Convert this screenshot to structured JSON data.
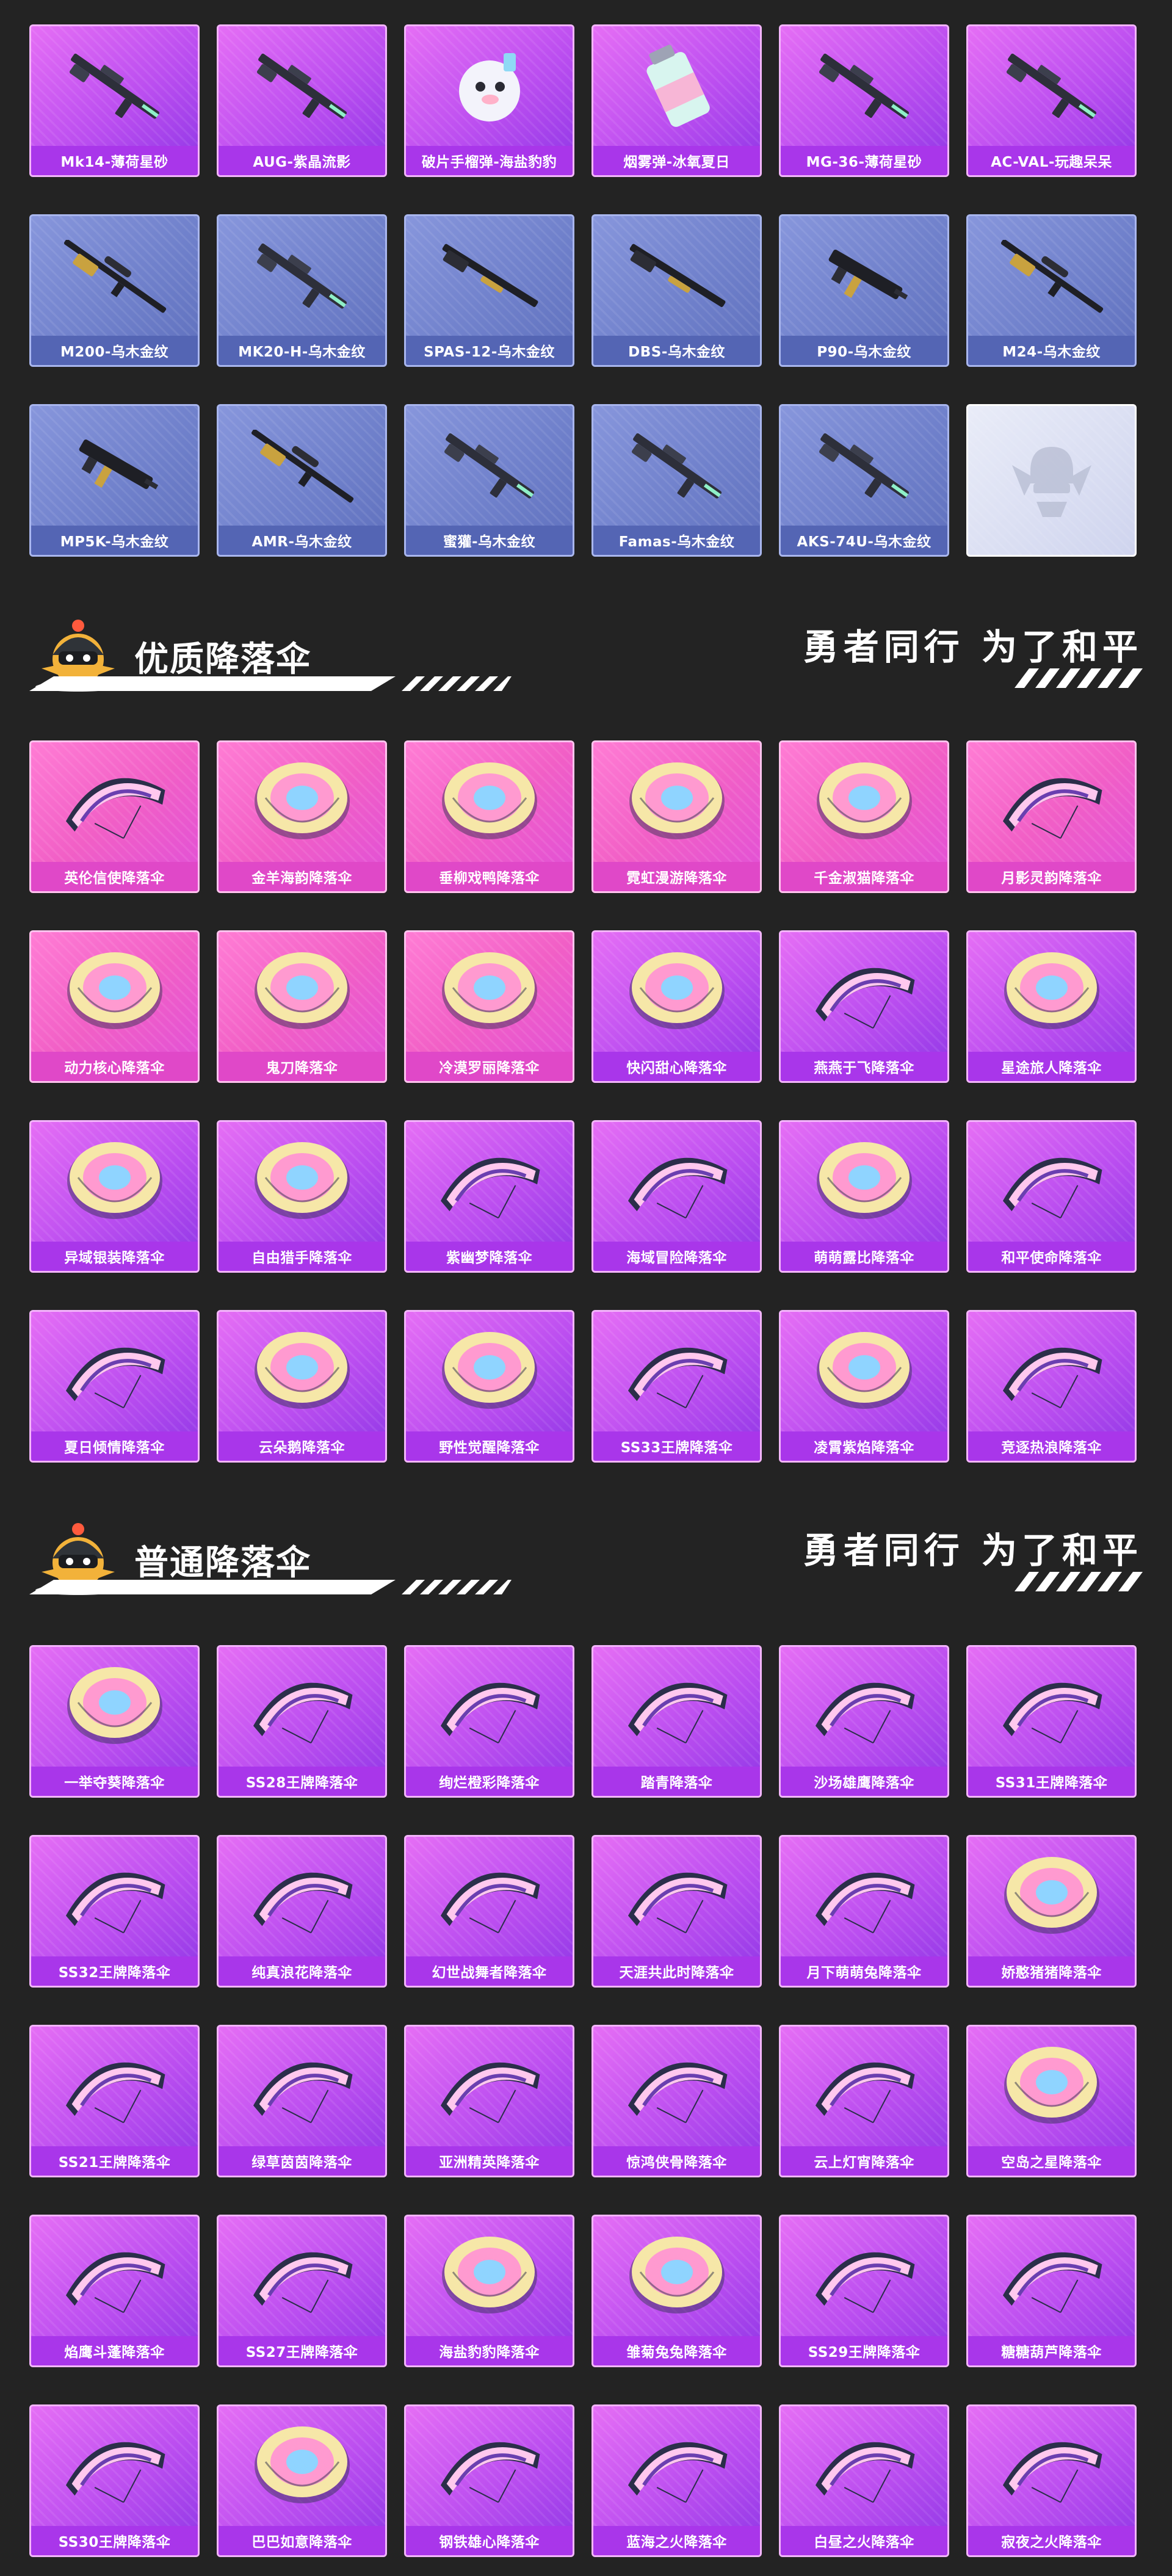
{
  "colors": {
    "page_bg": "#232323",
    "blue_card": "#6e7fca",
    "purple_card": "#bb4ef0",
    "pink_card": "#f15fc6",
    "label_text": "#ffffff"
  },
  "weapons": {
    "rows": [
      [
        {
          "label": "Mk14-薄荷星砂",
          "style": "purple",
          "icon": "rifle-icon"
        },
        {
          "label": "AUG-紫晶流影",
          "style": "purple",
          "icon": "rifle-icon"
        },
        {
          "label": "破片手榴弹-海盐豹豹",
          "style": "purple",
          "icon": "grenade-icon"
        },
        {
          "label": "烟雾弹-冰氧夏日",
          "style": "purple",
          "icon": "smoke-grenade-icon"
        },
        {
          "label": "MG-36-薄荷星砂",
          "style": "purple",
          "icon": "rifle-icon"
        },
        {
          "label": "AC-VAL-玩趣呆呆",
          "style": "purple",
          "icon": "rifle-icon"
        }
      ],
      [
        {
          "label": "M200-乌木金纹",
          "style": "blue",
          "icon": "sniper-rifle-icon"
        },
        {
          "label": "MK20-H-乌木金纹",
          "style": "blue",
          "icon": "rifle-icon"
        },
        {
          "label": "SPAS-12-乌木金纹",
          "style": "blue",
          "icon": "shotgun-icon"
        },
        {
          "label": "DBS-乌木金纹",
          "style": "blue",
          "icon": "shotgun-icon"
        },
        {
          "label": "P90-乌木金纹",
          "style": "blue",
          "icon": "smg-icon"
        },
        {
          "label": "M24-乌木金纹",
          "style": "blue",
          "icon": "sniper-rifle-icon"
        }
      ],
      [
        {
          "label": "MP5K-乌木金纹",
          "style": "blue",
          "icon": "smg-icon"
        },
        {
          "label": "AMR-乌木金纹",
          "style": "blue",
          "icon": "sniper-rifle-icon"
        },
        {
          "label": "蜜獾-乌木金纹",
          "style": "blue",
          "icon": "rifle-icon"
        },
        {
          "label": "Famas-乌木金纹",
          "style": "blue",
          "icon": "rifle-icon"
        },
        {
          "label": "AKS-74U-乌木金纹",
          "style": "blue",
          "icon": "rifle-icon"
        },
        {
          "label": "",
          "style": "empty",
          "icon": "game-emblem-icon"
        }
      ]
    ]
  },
  "section_premium": {
    "title": "优质降落伞",
    "slogan": "勇者同行 为了和平",
    "rows": [
      [
        {
          "label": "英伦信使降落伞",
          "style": "pink",
          "icon": "glider-icon"
        },
        {
          "label": "金羊海韵降落伞",
          "style": "pink",
          "icon": "parachute-icon"
        },
        {
          "label": "垂柳戏鸭降落伞",
          "style": "pink",
          "icon": "parachute-icon"
        },
        {
          "label": "霓虹漫游降落伞",
          "style": "pink",
          "icon": "parachute-icon"
        },
        {
          "label": "千金淑猫降落伞",
          "style": "pink",
          "icon": "parachute-icon"
        },
        {
          "label": "月影灵韵降落伞",
          "style": "pink",
          "icon": "glider-icon"
        }
      ],
      [
        {
          "label": "动力核心降落伞",
          "style": "pink",
          "icon": "parachute-icon"
        },
        {
          "label": "鬼刀降落伞",
          "style": "pink",
          "icon": "parachute-icon"
        },
        {
          "label": "冷漠罗丽降落伞",
          "style": "pink",
          "icon": "parachute-icon"
        },
        {
          "label": "快闪甜心降落伞",
          "style": "purple",
          "icon": "parachute-icon"
        },
        {
          "label": "燕燕于飞降落伞",
          "style": "purple",
          "icon": "glider-icon"
        },
        {
          "label": "星途旅人降落伞",
          "style": "purple",
          "icon": "parachute-icon"
        }
      ],
      [
        {
          "label": "异域银装降落伞",
          "style": "purple",
          "icon": "parachute-icon"
        },
        {
          "label": "自由猎手降落伞",
          "style": "purple",
          "icon": "parachute-icon"
        },
        {
          "label": "紫幽梦降落伞",
          "style": "purple",
          "icon": "glider-icon"
        },
        {
          "label": "海域冒险降落伞",
          "style": "purple",
          "icon": "glider-icon"
        },
        {
          "label": "萌萌露比降落伞",
          "style": "purple",
          "icon": "parachute-icon"
        },
        {
          "label": "和平使命降落伞",
          "style": "purple",
          "icon": "glider-icon"
        }
      ],
      [
        {
          "label": "夏日倾情降落伞",
          "style": "purple",
          "icon": "glider-icon"
        },
        {
          "label": "云朵鹅降落伞",
          "style": "purple",
          "icon": "parachute-icon"
        },
        {
          "label": "野性觉醒降落伞",
          "style": "purple",
          "icon": "parachute-icon"
        },
        {
          "label": "SS33王牌降落伞",
          "style": "purple",
          "icon": "glider-icon"
        },
        {
          "label": "凌霄紫焰降落伞",
          "style": "purple",
          "icon": "parachute-icon"
        },
        {
          "label": "竞逐热浪降落伞",
          "style": "purple",
          "icon": "glider-icon"
        }
      ]
    ]
  },
  "section_common": {
    "title": "普通降落伞",
    "slogan": "勇者同行 为了和平",
    "rows": [
      [
        {
          "label": "一举夺葵降落伞",
          "style": "purple",
          "icon": "parachute-icon"
        },
        {
          "label": "SS28王牌降落伞",
          "style": "purple",
          "icon": "glider-icon"
        },
        {
          "label": "绚烂橙彩降落伞",
          "style": "purple",
          "icon": "glider-icon"
        },
        {
          "label": "踏青降落伞",
          "style": "purple",
          "icon": "glider-icon"
        },
        {
          "label": "沙场雄鹰降落伞",
          "style": "purple",
          "icon": "glider-icon"
        },
        {
          "label": "SS31王牌降落伞",
          "style": "purple",
          "icon": "glider-icon"
        }
      ],
      [
        {
          "label": "SS32王牌降落伞",
          "style": "purple",
          "icon": "glider-icon"
        },
        {
          "label": "纯真浪花降落伞",
          "style": "purple",
          "icon": "glider-icon"
        },
        {
          "label": "幻世战舞者降落伞",
          "style": "purple",
          "icon": "glider-icon"
        },
        {
          "label": "天涯共此时降落伞",
          "style": "purple",
          "icon": "glider-icon"
        },
        {
          "label": "月下萌萌兔降落伞",
          "style": "purple",
          "icon": "glider-icon"
        },
        {
          "label": "娇憨猪猪降落伞",
          "style": "purple",
          "icon": "parachute-icon"
        }
      ],
      [
        {
          "label": "SS21王牌降落伞",
          "style": "purple",
          "icon": "glider-icon"
        },
        {
          "label": "绿草茵茵降落伞",
          "style": "purple",
          "icon": "glider-icon"
        },
        {
          "label": "亚洲精英降落伞",
          "style": "purple",
          "icon": "glider-icon"
        },
        {
          "label": "惊鸿侠骨降落伞",
          "style": "purple",
          "icon": "glider-icon"
        },
        {
          "label": "云上灯宵降落伞",
          "style": "purple",
          "icon": "glider-icon"
        },
        {
          "label": "空岛之星降落伞",
          "style": "purple",
          "icon": "parachute-icon"
        }
      ],
      [
        {
          "label": "焰鹰斗蓬降落伞",
          "style": "purple",
          "icon": "glider-icon"
        },
        {
          "label": "SS27王牌降落伞",
          "style": "purple",
          "icon": "glider-icon"
        },
        {
          "label": "海盐豹豹降落伞",
          "style": "purple",
          "icon": "parachute-icon"
        },
        {
          "label": "雏菊兔兔降落伞",
          "style": "purple",
          "icon": "parachute-icon"
        },
        {
          "label": "SS29王牌降落伞",
          "style": "purple",
          "icon": "glider-icon"
        },
        {
          "label": "糖糖葫芦降落伞",
          "style": "purple",
          "icon": "glider-icon"
        }
      ],
      [
        {
          "label": "SS30王牌降落伞",
          "style": "purple",
          "icon": "glider-icon"
        },
        {
          "label": "巴巴如意降落伞",
          "style": "purple",
          "icon": "parachute-icon"
        },
        {
          "label": "钢铁雄心降落伞",
          "style": "purple",
          "icon": "glider-icon"
        },
        {
          "label": "蓝海之火降落伞",
          "style": "purple",
          "icon": "glider-icon"
        },
        {
          "label": "白昼之火降落伞",
          "style": "purple",
          "icon": "glider-icon"
        },
        {
          "label": "寂夜之火降落伞",
          "style": "purple",
          "icon": "glider-icon"
        }
      ]
    ]
  }
}
